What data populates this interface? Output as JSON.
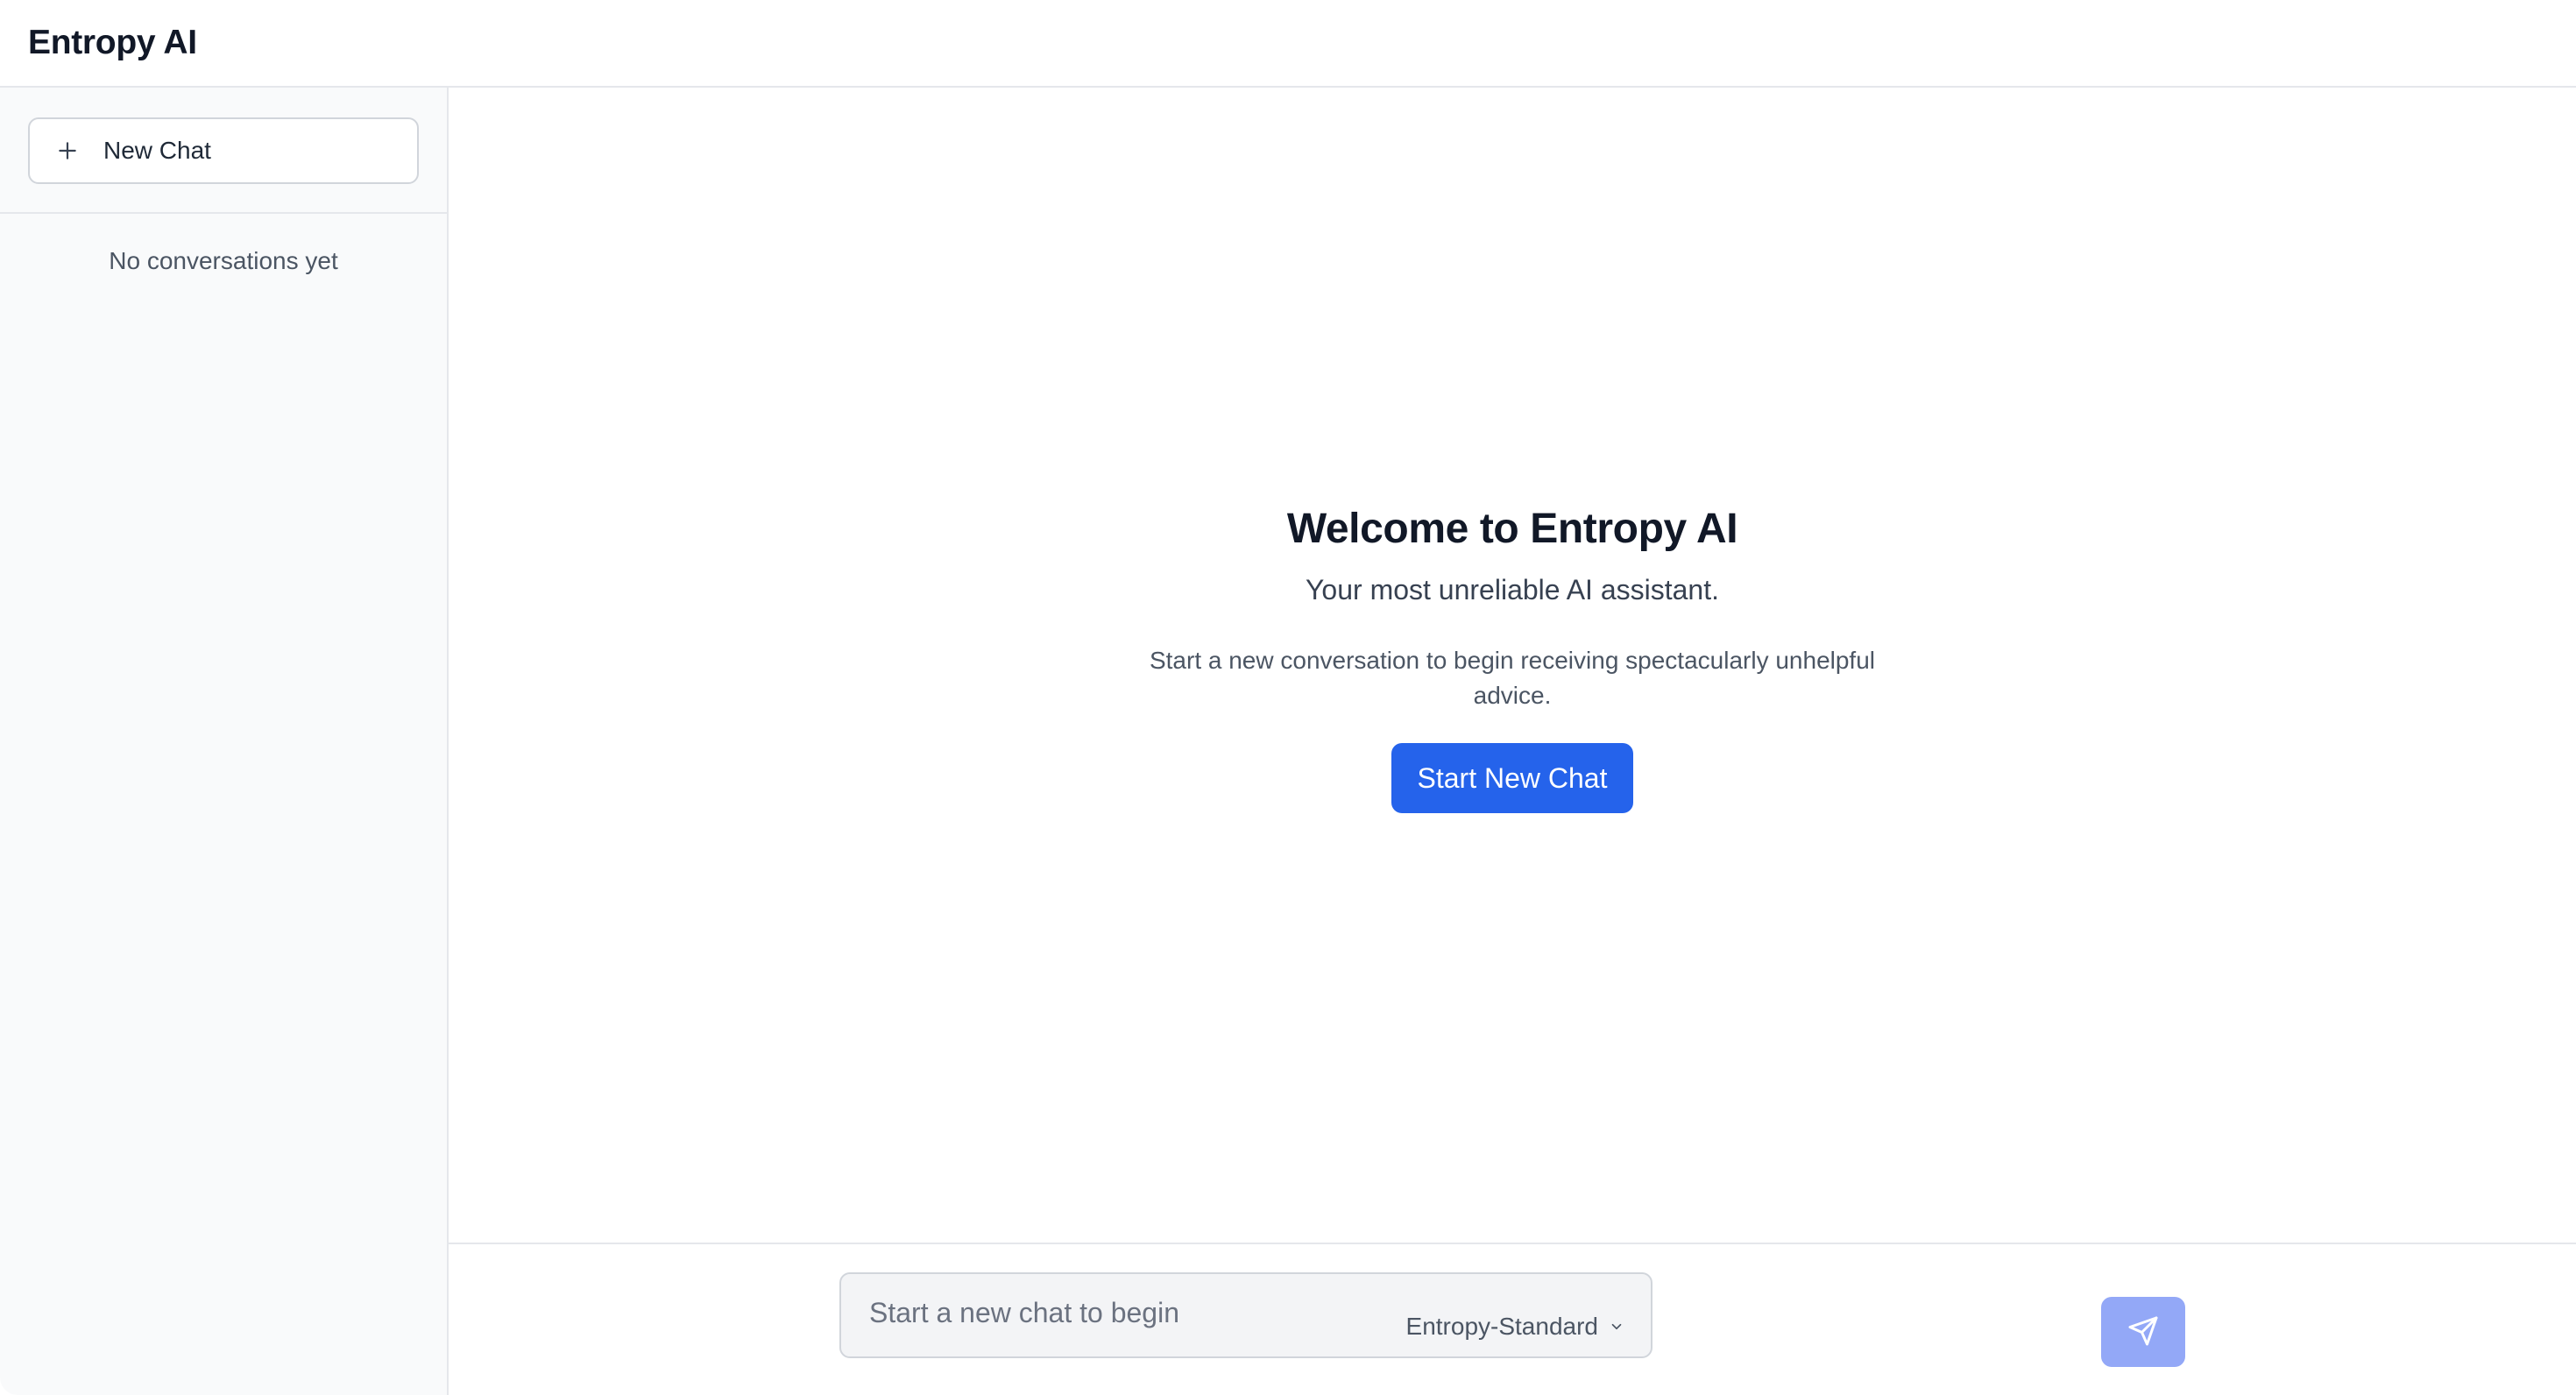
{
  "app": {
    "title": "Entropy AI"
  },
  "sidebar": {
    "new_chat_label": "New Chat",
    "new_chat_icon": "plus-icon",
    "empty_text": "No conversations yet"
  },
  "welcome": {
    "title": "Welcome to Entropy AI",
    "subtitle": "Your most unreliable AI assistant.",
    "description": "Start a new conversation to begin receiving spectacularly unhelpful advice.",
    "start_button_label": "Start New Chat"
  },
  "composer": {
    "placeholder": "Start a new chat to begin",
    "value": "",
    "model_selected": "Entropy-Standard",
    "model_icon": "chevron-down-icon",
    "send_icon": "send-icon"
  },
  "colors": {
    "accent": "#2563eb",
    "send_disabled": "#93a8f7",
    "sidebar_bg": "#f9fafb",
    "border": "#e5e7eb"
  }
}
